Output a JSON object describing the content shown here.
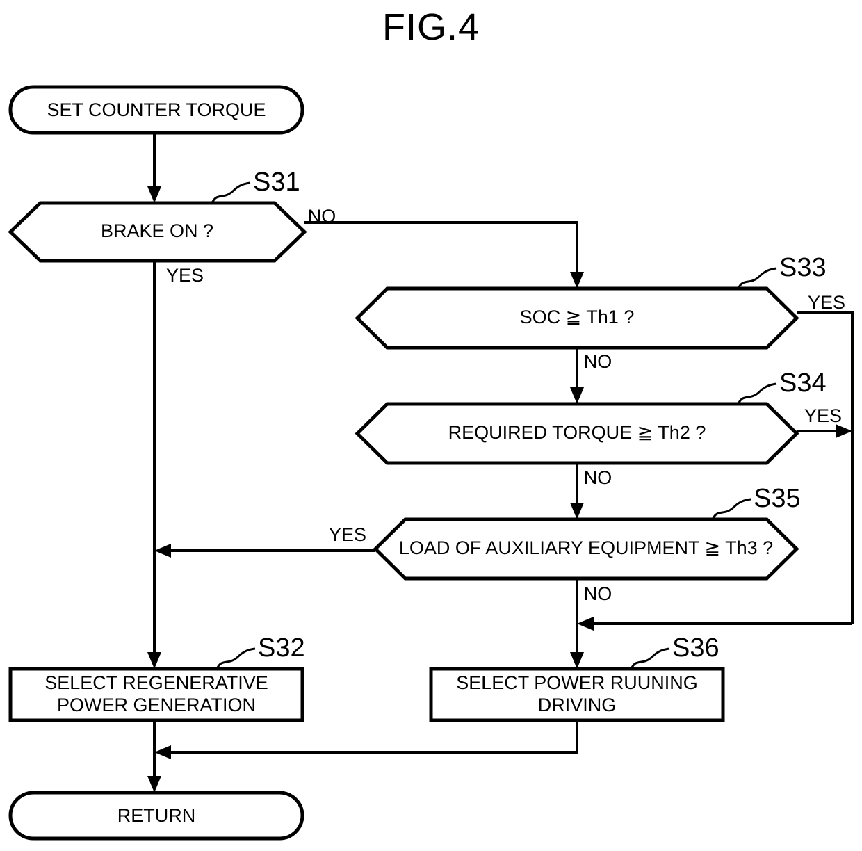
{
  "figure": {
    "title": "FIG.4",
    "type": "flowchart"
  },
  "nodes": {
    "start": {
      "id": "start",
      "shape": "terminal",
      "label": "SET COUNTER TORQUE"
    },
    "s31": {
      "id": "S31",
      "shape": "decision",
      "label": "BRAKE ON ?",
      "step": "S31"
    },
    "s33": {
      "id": "S33",
      "shape": "decision",
      "label": "SOC ≧ Th1 ?",
      "step": "S33"
    },
    "s34": {
      "id": "S34",
      "shape": "decision",
      "label": "REQUIRED TORQUE ≧ Th2 ?",
      "step": "S34"
    },
    "s35": {
      "id": "S35",
      "shape": "decision",
      "label": "LOAD OF AUXILIARY EQUIPMENT ≧ Th3 ?",
      "step": "S35"
    },
    "s32": {
      "id": "S32",
      "shape": "process",
      "label_line1": "SELECT REGENERATIVE",
      "label_line2": "POWER GENERATION",
      "step": "S32"
    },
    "s36": {
      "id": "S36",
      "shape": "process",
      "label_line1": "SELECT POWER RUUNING",
      "label_line2": "DRIVING",
      "step": "S36"
    },
    "end": {
      "id": "end",
      "shape": "terminal",
      "label": "RETURN"
    }
  },
  "branches": {
    "s31_no": "NO",
    "s31_yes": "YES",
    "s33_yes": "YES",
    "s33_no": "NO",
    "s34_yes": "YES",
    "s34_no": "NO",
    "s35_yes": "YES",
    "s35_no": "NO"
  },
  "colors": {
    "stroke": "#000000",
    "fill": "#ffffff",
    "background": "#ffffff"
  }
}
